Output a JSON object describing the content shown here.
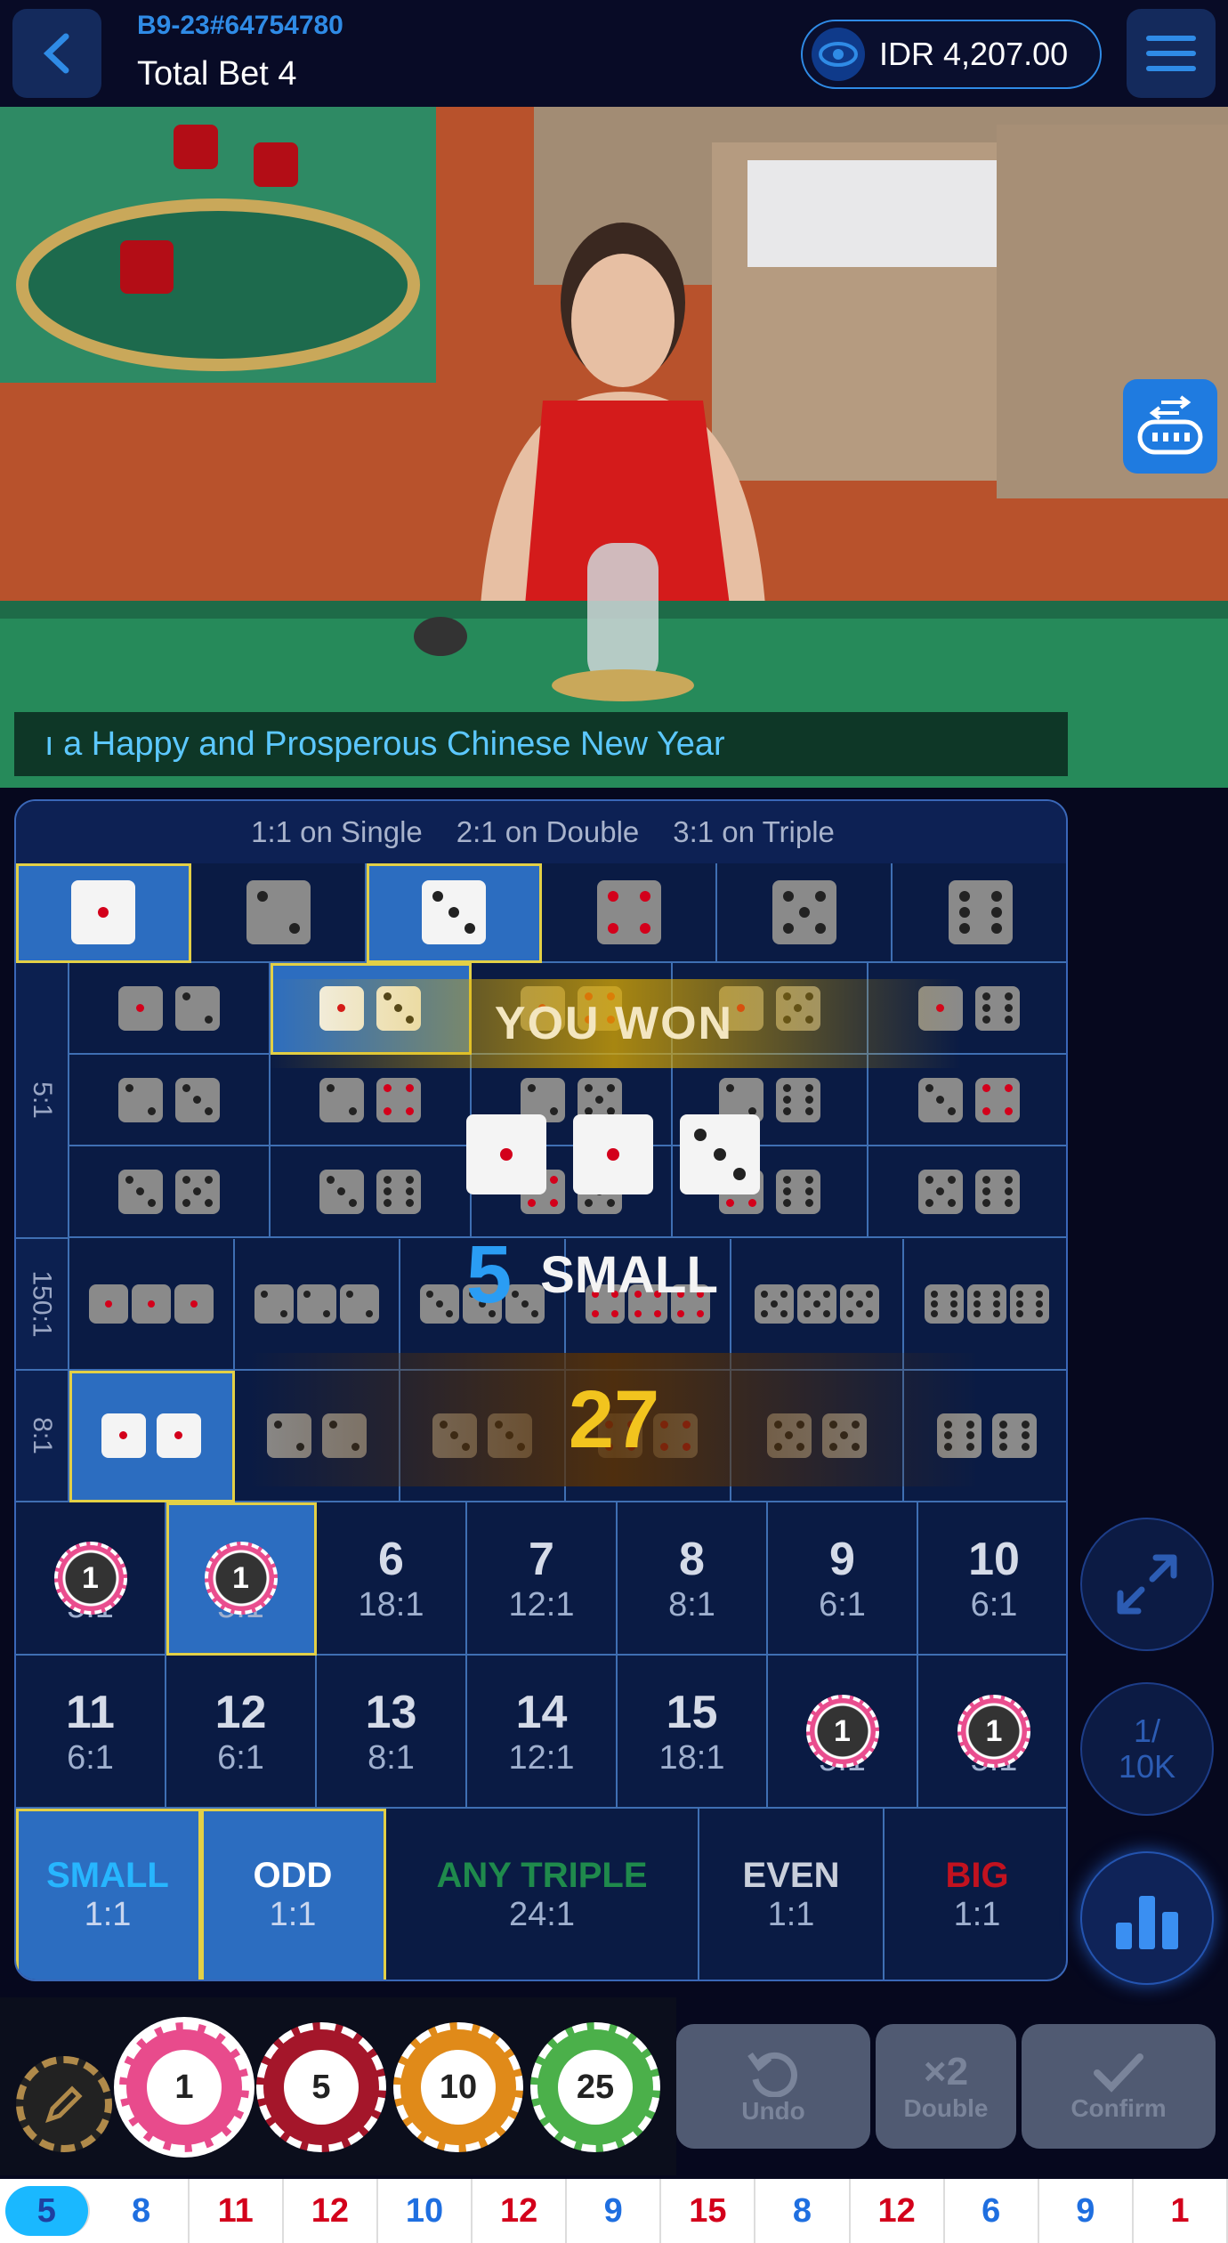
{
  "header": {
    "table_id": "B9-23#64754780",
    "total_bet": "Total Bet 4",
    "balance": "IDR 4,207.00"
  },
  "ticker": "ı a Happy and Prosperous Chinese New Year",
  "board": {
    "odds_header": [
      "1:1 on Single",
      "2:1 on Double",
      "3:1 on Triple"
    ],
    "side_labels": [
      "5:1",
      "150:1",
      "8:1"
    ],
    "totals_row1": [
      {
        "num": "",
        "odds": "5:1"
      },
      {
        "num": "",
        "odds": "5:1"
      },
      {
        "num": "6",
        "odds": "18:1"
      },
      {
        "num": "7",
        "odds": "12:1"
      },
      {
        "num": "8",
        "odds": "8:1"
      },
      {
        "num": "9",
        "odds": "6:1"
      },
      {
        "num": "10",
        "odds": "6:1"
      }
    ],
    "totals_row2": [
      {
        "num": "11",
        "odds": "6:1"
      },
      {
        "num": "12",
        "odds": "6:1"
      },
      {
        "num": "13",
        "odds": "8:1"
      },
      {
        "num": "14",
        "odds": "12:1"
      },
      {
        "num": "15",
        "odds": "18:1"
      },
      {
        "num": "",
        "odds": "5:1"
      },
      {
        "num": "",
        "odds": "5:1"
      }
    ],
    "bets": [
      {
        "label": "SMALL",
        "odds": "1:1",
        "color": "#27b6ff"
      },
      {
        "label": "ODD",
        "odds": "1:1",
        "color": "#ffffff"
      },
      {
        "label": "ANY TRIPLE",
        "odds": "24:1",
        "color": "#1f8a4c"
      },
      {
        "label": "EVEN",
        "odds": "1:1",
        "color": "#c9cfdb"
      },
      {
        "label": "BIG",
        "odds": "1:1",
        "color": "#c2121f"
      }
    ],
    "chip_value": "1"
  },
  "overlay": {
    "you_won": "YOU WON",
    "total": "5",
    "result": "SMALL",
    "win_amount": "27"
  },
  "side_buttons": {
    "limit": "1/\n10K"
  },
  "chips": [
    "1",
    "5",
    "10",
    "25"
  ],
  "actions": {
    "undo": "Undo",
    "double_icon": "×2",
    "double": "Double",
    "confirm": "Confirm"
  },
  "history": [
    "5",
    "8",
    "11",
    "12",
    "10",
    "12",
    "9",
    "15",
    "8",
    "12",
    "6",
    "9",
    "1"
  ],
  "history_colors": [
    "#1f6fe0",
    "#1f6fe0",
    "#d3001b",
    "#d3001b",
    "#1f6fe0",
    "#d3001b",
    "#1f6fe0",
    "#d3001b",
    "#1f6fe0",
    "#d3001b",
    "#1f6fe0",
    "#1f6fe0",
    "#d3001b"
  ]
}
